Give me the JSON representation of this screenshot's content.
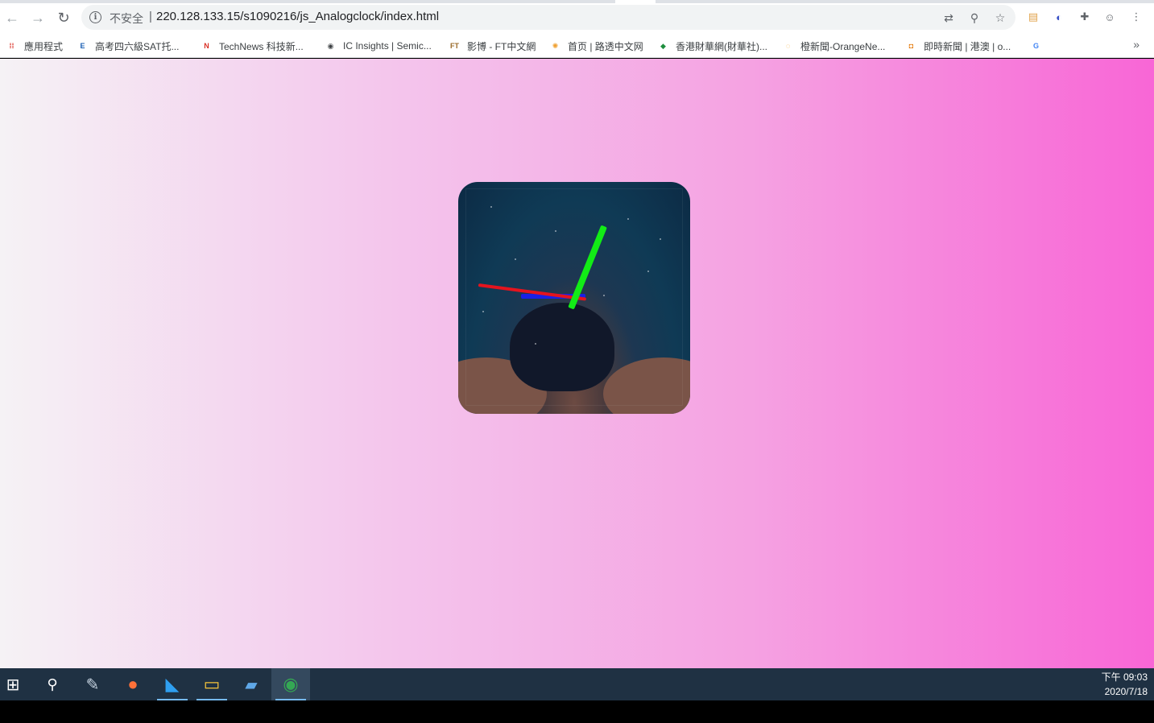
{
  "browser": {
    "security_label": "不安全",
    "separator": "|",
    "url": "220.128.133.15/s1090216/js_Analogclock/index.html",
    "nav": {
      "back": "←",
      "forward": "→",
      "reload": "↻"
    }
  },
  "omnibox_icons": [
    {
      "name": "translate-icon",
      "glyph": "⇄"
    },
    {
      "name": "zoom-icon",
      "glyph": "⚲"
    },
    {
      "name": "star-icon",
      "glyph": "☆"
    }
  ],
  "extensions": [
    {
      "name": "smart-pdf-icon",
      "glyph": "▤",
      "color": "#e0a34c"
    },
    {
      "name": "extension-s-icon",
      "glyph": "◐",
      "color": "#3a52c6"
    },
    {
      "name": "puzzle-icon",
      "glyph": "✚",
      "color": "#5f6368"
    },
    {
      "name": "profile-icon",
      "glyph": "☺",
      "color": "#5f6368"
    },
    {
      "name": "menu-icon",
      "glyph": "⋮",
      "color": "#5f6368"
    }
  ],
  "bookmarks": [
    {
      "label": "應用程式",
      "icon": "apps-grid-icon",
      "fav": "⁞⁞",
      "color": "#d93025"
    },
    {
      "label": "高考四六級SAT托...",
      "icon": "exam-icon",
      "fav": "E",
      "color": "#1a5fb4"
    },
    {
      "label": "TechNews 科技新...",
      "icon": "technews-icon",
      "fav": "N",
      "color": "#d93025"
    },
    {
      "label": "IC Insights | Semic...",
      "icon": "globe-icon",
      "fav": "◉",
      "color": "#3c4043"
    },
    {
      "label": "影博 - FT中文網",
      "icon": "ft-icon",
      "fav": "FT",
      "color": "#9a6b2a"
    },
    {
      "label": "首页 | 路透中文网",
      "icon": "reuters-icon",
      "fav": "✺",
      "color": "#f0a030"
    },
    {
      "label": "香港財華網(財華社)...",
      "icon": "finet-icon",
      "fav": "◆",
      "color": "#1e8e3e"
    },
    {
      "label": "橙新聞-OrangeNe...",
      "icon": "orange-news-icon",
      "fav": "◌",
      "color": "#f29900"
    },
    {
      "label": "即時新聞 | 港澳 | o...",
      "icon": "news-icon",
      "fav": "◘",
      "color": "#e37400"
    },
    {
      "label": "",
      "icon": "google-icon",
      "fav": "G",
      "color": "#4285f4"
    }
  ],
  "bookmarks_more": "»",
  "taskbar": {
    "apps": [
      {
        "name": "start-icon",
        "glyph": "⊞",
        "color": "#ffffff"
      },
      {
        "name": "search-icon",
        "glyph": "⚲",
        "color": "#ffffff"
      },
      {
        "name": "paint-app-icon",
        "glyph": "✎",
        "color": "#c9d6e3"
      },
      {
        "name": "firefox-icon",
        "glyph": "●",
        "color": "#ff7139"
      },
      {
        "name": "vscode-icon",
        "glyph": "◣",
        "color": "#2f9ff0"
      },
      {
        "name": "file-explorer-icon",
        "glyph": "▭",
        "color": "#f5c33b"
      },
      {
        "name": "remote-desktop-icon",
        "glyph": "▰",
        "color": "#5fa8e8"
      },
      {
        "name": "chrome-icon",
        "glyph": "◉",
        "color": "#34a853"
      }
    ],
    "time": "下午 09:03",
    "date": "2020/7/18"
  }
}
